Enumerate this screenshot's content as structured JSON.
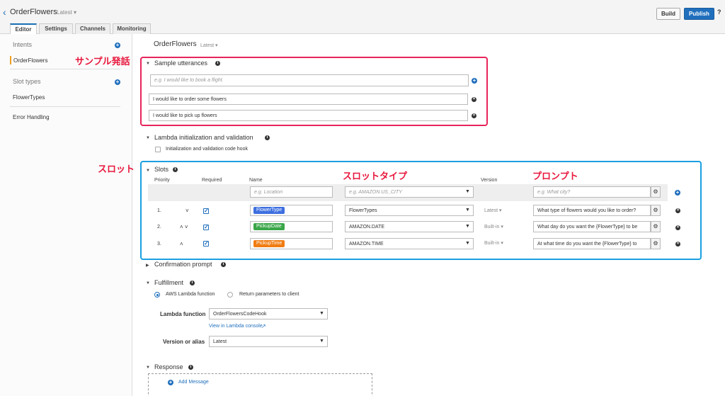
{
  "header": {
    "back_glyph": "‹",
    "title": "OrderFlowers",
    "version": "Latest ▾",
    "build": "Build",
    "publish": "Publish",
    "help": "?"
  },
  "tabs": [
    "Editor",
    "Settings",
    "Channels",
    "Monitoring"
  ],
  "sidebar": {
    "intents": "Intents",
    "intent_item": "OrderFlowers",
    "slot_types": "Slot types",
    "slot_item": "FlowerTypes",
    "error_handling": "Error Handling"
  },
  "main": {
    "intent_title": "OrderFlowers",
    "intent_version": "Latest ▾",
    "sample": {
      "title": "Sample utterances",
      "placeholder": "e.g. I would like to book a flight.",
      "items": [
        "I would like to order some flowers",
        "I would like to pick up flowers"
      ]
    },
    "lambda_init": {
      "title": "Lambda initialization and validation",
      "checkbox": "Initialization and validation code hook"
    },
    "slots": {
      "title": "Slots",
      "headers": {
        "priority": "Priority",
        "required": "Required",
        "name": "Name",
        "version": "Version"
      },
      "new_name_ph": "e.g. Location",
      "new_type_ph": "e.g. AMAZON.US_CITY",
      "new_prompt_ph": "e.g. What city?",
      "rows": [
        {
          "priority": "1.",
          "arrows": "˅",
          "name": "FlowerType",
          "type": "FlowerTypes",
          "version": "Latest ▾",
          "prompt": "What type of flowers would you like to order?",
          "color": "#3e6fe0"
        },
        {
          "priority": "2.",
          "arrows": "˄ ˅",
          "name": "PickupDate",
          "type": "AMAZON.DATE",
          "version": "Built-in ▾",
          "prompt": "What day do you want the {FlowerType} to be",
          "color": "#3aa648"
        },
        {
          "priority": "3.",
          "arrows": "˄",
          "name": "PickupTime",
          "type": "AMAZON.TIME",
          "version": "Built-in ▾",
          "prompt": "At what time do you want the {FlowerType} to",
          "color": "#f07c12"
        }
      ]
    },
    "confirmation": {
      "title": "Confirmation prompt"
    },
    "fulfillment": {
      "title": "Fulfillment",
      "opt_lambda": "AWS Lambda function",
      "opt_return": "Return parameters to client",
      "lambda_label": "Lambda function",
      "lambda_value": "OrderFlowersCodeHook",
      "console_link": "View in Lambda console",
      "version_label": "Version or alias",
      "version_value": "Latest"
    },
    "response": {
      "title": "Response",
      "add_message": "Add Message"
    }
  },
  "annotations": {
    "sample": "サンプル発話",
    "slot": "スロット",
    "slot_type": "スロットタイプ",
    "prompt": "プロンプト"
  },
  "colors": {
    "primary": "#1f6fbd",
    "annotation_text": "#e8173c",
    "pink_box": "#e8245a",
    "blue_box": "#1aa0e0"
  }
}
